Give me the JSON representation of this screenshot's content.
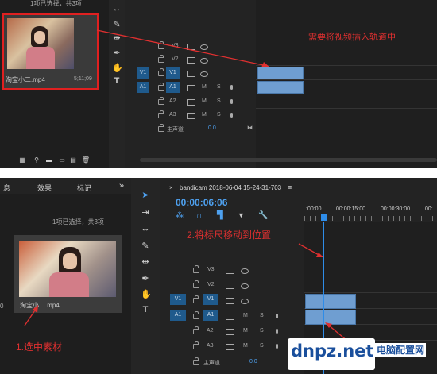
{
  "top": {
    "selection_status": "1项已选择，共3项",
    "clip_name": "淘宝小二.mp4",
    "clip_duration": "5;11;09",
    "tracks": [
      {
        "name": "V3",
        "type": "video"
      },
      {
        "name": "V2",
        "type": "video"
      },
      {
        "name": "V1",
        "type": "video",
        "source": "V1"
      },
      {
        "name": "A1",
        "type": "audio",
        "source": "A1",
        "m": "M",
        "s": "S"
      },
      {
        "name": "A2",
        "type": "audio",
        "m": "M",
        "s": "S"
      },
      {
        "name": "A3",
        "type": "audio",
        "m": "M",
        "s": "S"
      }
    ],
    "master_label": "主声道",
    "master_value": "0.0",
    "annotation": "需要将视频插入轨道中"
  },
  "bottom": {
    "tabs": [
      "息",
      "效果",
      "标记"
    ],
    "more_icon": "»",
    "selection_status": "1项已选择，共3项",
    "clip_name": "淘宝小二.mp4",
    "sequence_name": "bandicam 2018-06-04 15-24-31-703",
    "menu_icon": "≡",
    "timecode": "00:00:06:06",
    "ruler": [
      ":00:00",
      "00:00:15:00",
      "00:00:30:00",
      "00:"
    ],
    "tracks": [
      {
        "name": "V3",
        "type": "video"
      },
      {
        "name": "V2",
        "type": "video"
      },
      {
        "name": "V1",
        "type": "video",
        "source": "V1"
      },
      {
        "name": "A1",
        "type": "audio",
        "source": "A1",
        "m": "M",
        "s": "S"
      },
      {
        "name": "A2",
        "type": "audio",
        "m": "M",
        "s": "S"
      },
      {
        "name": "A3",
        "type": "audio",
        "m": "M",
        "s": "S"
      }
    ],
    "master_label": "主声道",
    "master_value": "0.0",
    "annotation_1": "1.选中素材",
    "annotation_2": "2.将标尺移动到位置",
    "side_number": "0"
  },
  "watermark": {
    "brand": "dnpz.net",
    "cn": "电脑配置网"
  },
  "colors": {
    "accent_blue": "#2e8ce8",
    "annotation_red": "#e03030",
    "track_blue": "#1f5a8c",
    "clip": "#6f9ed1"
  }
}
